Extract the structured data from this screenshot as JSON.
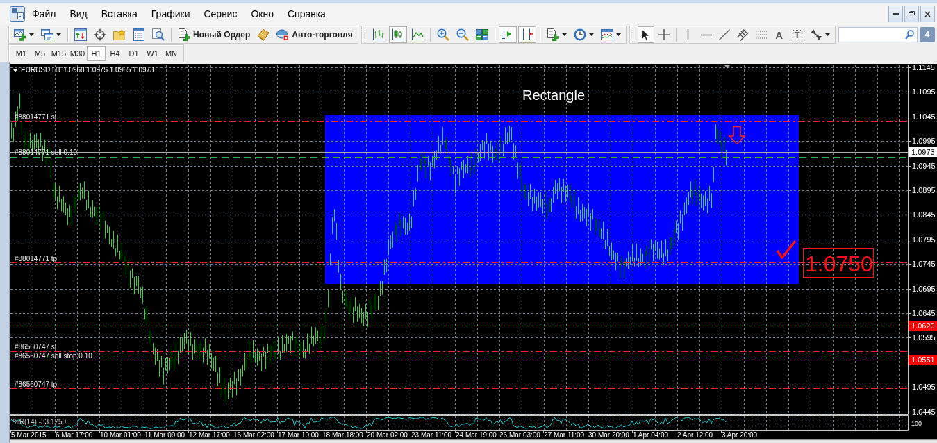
{
  "menu": {
    "items": [
      "Файл",
      "Вид",
      "Вставка",
      "Графики",
      "Сервис",
      "Окно",
      "Справка"
    ]
  },
  "toolbar": {
    "panels": [
      {
        "groups": [
          [
            {
              "kind": "icon",
              "pressed": false
            },
            {
              "kind": "icon",
              "pressed": false
            }
          ],
          [
            {
              "kind": "icon",
              "pressed": false
            },
            {
              "kind": "icon",
              "pressed": false
            },
            {
              "kind": "icon",
              "pressed": false
            },
            {
              "kind": "icon",
              "pressed": false
            },
            {
              "kind": "icon",
              "pressed": false
            }
          ],
          [
            {
              "kind": "labeled",
              "label": "Новый Ордер",
              "pressed": false
            },
            {
              "kind": "icon",
              "pressed": false
            },
            {
              "kind": "labeled",
              "label": "Авто-торговля",
              "pressed": false
            }
          ]
        ]
      },
      {
        "groups": [
          [
            {
              "kind": "icon",
              "pressed": false
            },
            {
              "kind": "icon",
              "pressed": true
            },
            {
              "kind": "icon",
              "pressed": false
            }
          ],
          [
            {
              "kind": "icon",
              "pressed": false
            },
            {
              "kind": "icon",
              "pressed": false
            },
            {
              "kind": "icon",
              "pressed": false
            }
          ],
          [
            {
              "kind": "icon",
              "pressed": true
            },
            {
              "kind": "icon",
              "pressed": true
            }
          ],
          [
            {
              "kind": "icon",
              "pressed": false
            },
            {
              "kind": "icon",
              "pressed": false
            },
            {
              "kind": "icon",
              "pressed": false
            }
          ]
        ]
      },
      {
        "groups": [
          [
            {
              "kind": "icon",
              "pressed": true
            },
            {
              "kind": "icon",
              "pressed": false
            }
          ],
          [
            {
              "kind": "icon",
              "pressed": false
            },
            {
              "kind": "icon",
              "pressed": false
            },
            {
              "kind": "icon",
              "pressed": false
            },
            {
              "kind": "icon",
              "pressed": false
            },
            {
              "kind": "icon",
              "pressed": false
            },
            {
              "kind": "glyph",
              "label": "A",
              "pressed": false
            },
            {
              "kind": "glyph",
              "label": "T",
              "pressed": false
            },
            {
              "kind": "icon",
              "pressed": false
            }
          ]
        ]
      }
    ]
  },
  "messages_badge": "4",
  "timeframes": [
    {
      "label": "M1",
      "selected": false
    },
    {
      "label": "M5",
      "selected": false
    },
    {
      "label": "M15",
      "selected": false
    },
    {
      "label": "M30",
      "selected": false
    },
    {
      "label": "H1",
      "selected": true
    },
    {
      "label": "H4",
      "selected": false
    },
    {
      "label": "D1",
      "selected": false
    },
    {
      "label": "W1",
      "selected": false
    },
    {
      "label": "MN",
      "selected": false
    }
  ],
  "chart": {
    "symbol": "EURUSD,H1",
    "quotes": "1.0968 1.0975 1.0965 1.0973",
    "objects": [
      {
        "kind": "rectangle",
        "label": "Rectangle"
      },
      {
        "kind": "arrow_down"
      },
      {
        "kind": "check"
      },
      {
        "kind": "price_label",
        "text": "1.0750"
      }
    ],
    "order_lines": [
      {
        "kind": "stop",
        "label": "#88014771 sl"
      },
      {
        "kind": "entry",
        "label": "#88014771 sell 0.10"
      },
      {
        "kind": "stop",
        "label": "#88014771 tp"
      },
      {
        "kind": "stop",
        "label": "#86560747 sl"
      },
      {
        "kind": "entry",
        "label": "#86560747 sell stop 0.10"
      },
      {
        "kind": "stop",
        "label": "#86560747 tp"
      }
    ],
    "price_scale": [
      "1.1145",
      "1.1095",
      "1.1045",
      "1.0995",
      "1.0945",
      "1.0895",
      "1.0845",
      "1.0795",
      "1.0745",
      "1.0695",
      "1.0645",
      "1.0595",
      "1.0495",
      "1.0445"
    ],
    "bid_price": "1.0973",
    "level_tags": [
      "1.0620",
      "1.0551"
    ],
    "time_scale": [
      "5 Mar 2015",
      "6 Mar 17:00",
      "10 Mar 01:00",
      "11 Mar 09:00",
      "12 Mar 17:00",
      "16 Mar 02:00",
      "17 Mar 10:00",
      "18 Mar 18:00",
      "20 Mar 02:00",
      "23 Mar 11:00",
      "24 Mar 19:00",
      "26 Mar 03:00",
      "27 Mar 11:00",
      "30 Mar 20:00",
      "1 Apr 04:00",
      "2 Apr 12:00",
      "3 Apr 20:00"
    ],
    "indicator": {
      "label": "%R(14) -33.1250",
      "scale": [
        "100"
      ]
    }
  }
}
